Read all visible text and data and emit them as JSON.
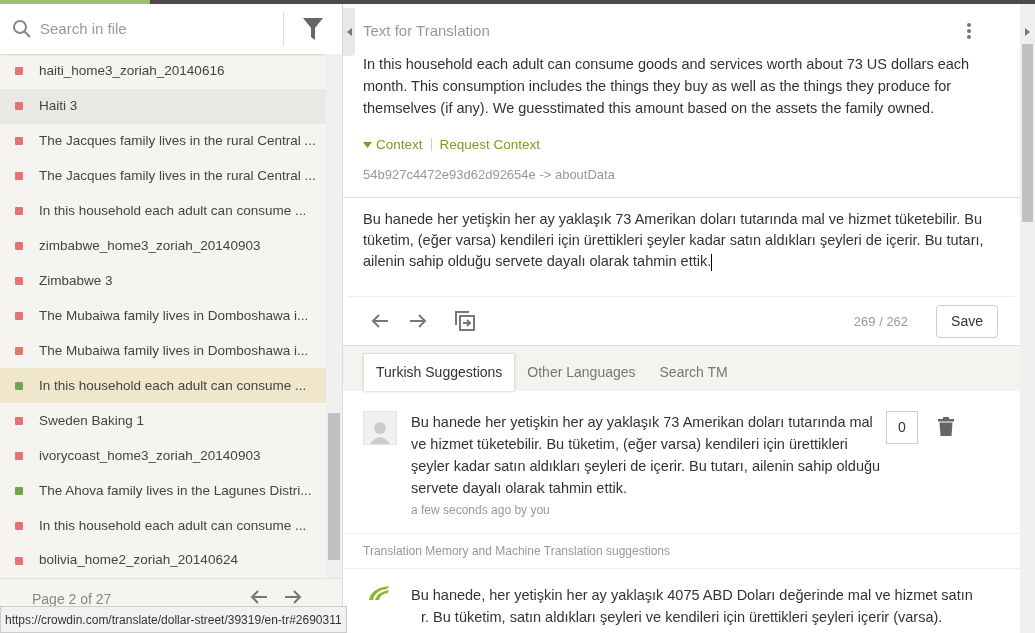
{
  "progress": {
    "level": 0.145
  },
  "search": {
    "placeholder": "Search in file"
  },
  "strings": [
    {
      "label": "haiti_home3_zoriah_20140616",
      "color": "#e57373",
      "selected": false,
      "hovered": false
    },
    {
      "label": "Haiti 3",
      "color": "#e57373",
      "selected": false,
      "hovered": true
    },
    {
      "label": "The Jacques family lives in the rural Central ...",
      "color": "#e57373",
      "selected": false,
      "hovered": false
    },
    {
      "label": "The Jacques family lives in the rural Central ...",
      "color": "#e57373",
      "selected": false,
      "hovered": false
    },
    {
      "label": "In this household each adult can consume ...",
      "color": "#e57373",
      "selected": false,
      "hovered": false
    },
    {
      "label": "zimbabwe_home3_zoriah_20140903",
      "color": "#e57373",
      "selected": false,
      "hovered": false
    },
    {
      "label": "Zimbabwe 3",
      "color": "#e57373",
      "selected": false,
      "hovered": false
    },
    {
      "label": "The Mubaiwa family lives in Domboshawa i...",
      "color": "#e57373",
      "selected": false,
      "hovered": false
    },
    {
      "label": "The Mubaiwa family lives in Domboshawa i...",
      "color": "#e57373",
      "selected": false,
      "hovered": false
    },
    {
      "label": "In this household each adult can consume ...",
      "color": "#6ea64b",
      "selected": true,
      "hovered": false
    },
    {
      "label": "Sweden Baking 1",
      "color": "#e57373",
      "selected": false,
      "hovered": false
    },
    {
      "label": "ivorycoast_home3_zoriah_20140903",
      "color": "#e57373",
      "selected": false,
      "hovered": false
    },
    {
      "label": "The Ahova family lives in the Lagunes Distri...",
      "color": "#6ea64b",
      "selected": false,
      "hovered": false
    },
    {
      "label": "In this household each adult can consume ...",
      "color": "#e57373",
      "selected": false,
      "hovered": false
    },
    {
      "label": "bolivia_home2_zoriah_20140624",
      "color": "#e57373",
      "selected": false,
      "hovered": false
    }
  ],
  "pagination": {
    "label": "Page 2 of 27"
  },
  "status_url": "https://crowdin.com/translate/dollar-street/39319/en-tr#2690311",
  "source": {
    "title": "Text for Translation",
    "text": "In this household each adult can consume goods and services worth about 73 US dollars each month. This consumption includes the things they buy as well as the things they produce for themselves (if any). We guesstimated this amount based on the assets the family owned.",
    "context_label": "Context",
    "context_expanded": true,
    "request_context": "Request Context",
    "key": "54b927c4472e93d62d92654e -> aboutData"
  },
  "translation": {
    "value": "Bu hanede her yetişkin her ay yaklaşık 73 Amerikan doları tutarında mal ve hizmet tüketebilir. Bu tüketim, (eğer varsa) kendileri için ürettikleri şeyler kadar satın aldıkları şeyleri de içerir. Bu tutarı, ailenin sahip olduğu servete dayalı olarak tahmin ettik.",
    "counter": "269 / 262",
    "save": "Save"
  },
  "tabs": [
    {
      "label": "Turkish Suggestions",
      "selected": true
    },
    {
      "label": "Other Languages",
      "selected": false
    },
    {
      "label": "Search TM",
      "selected": false
    }
  ],
  "suggestion": {
    "text": "Bu hanede her yetişkin her ay yaklaşık 73 Amerikan doları tutarında mal ve hizmet tüketebilir. Bu tüketim, (eğer varsa) kendileri için ürettikleri şeyler kadar satın aldıkları şeyleri de içerir. Bu tutarı, ailenin sahip olduğu servete dayalı olarak tahmin ettik.",
    "meta": "a few seconds ago by you",
    "votes": "0"
  },
  "tm_heading": "Translation Memory and Machine Translation suggestions",
  "mt_suggestion": {
    "line_1": "Bu hanede, her yetişkin her ay yaklaşık 4075 ABD Doları değerinde mal ve hizmet satın",
    "line_2": "r. Bu tüketim, satın aldıkları şeyleri ve kendileri için ürettikleri şeyleri içerir (varsa)."
  }
}
